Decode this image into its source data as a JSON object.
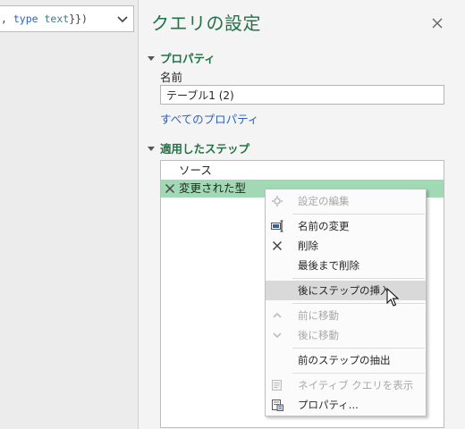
{
  "formula_bar": {
    "text_prefix": ", ",
    "keyword": "type",
    "space": " ",
    "type_name": "text",
    "text_suffix": "}})"
  },
  "query_settings": {
    "title": "クエリの設定",
    "properties_header": "プロパティ",
    "name_label": "名前",
    "name_value": "テーブル1 (2)",
    "all_properties_link": "すべてのプロパティ",
    "applied_steps_header": "適用したステップ",
    "steps": [
      {
        "label": "ソース"
      },
      {
        "label": "変更された型"
      }
    ]
  },
  "context_menu": {
    "items": [
      {
        "label": "設定の編集",
        "disabled": true
      },
      {
        "label": "名前の変更",
        "disabled": false
      },
      {
        "label": "削除",
        "disabled": false
      },
      {
        "label": "最後まで削除",
        "disabled": false
      },
      {
        "label": "後にステップの挿入",
        "disabled": false,
        "hover": true
      },
      {
        "label": "前に移動",
        "disabled": true
      },
      {
        "label": "後に移動",
        "disabled": true
      },
      {
        "label": "前のステップの抽出",
        "disabled": false
      },
      {
        "label": "ネイティブ クエリを表示",
        "disabled": true
      },
      {
        "label": "プロパティ...",
        "disabled": false
      }
    ]
  },
  "colors": {
    "accent_green": "#217346",
    "selected_step": "#a0d9b3",
    "link_blue": "#2e62b8"
  },
  "icons": [
    "chevron-down-icon",
    "close-icon",
    "delete-x-icon",
    "gear-icon",
    "rename-icon",
    "move-up-icon",
    "move-down-icon",
    "native-query-icon",
    "properties-icon",
    "mouse-cursor-icon"
  ]
}
